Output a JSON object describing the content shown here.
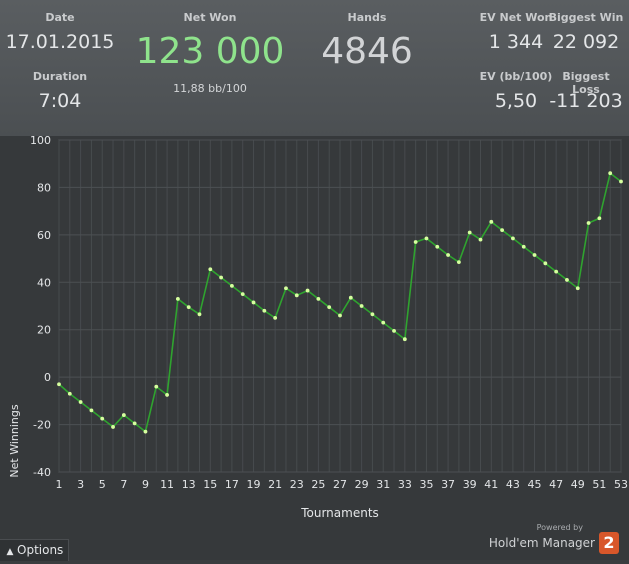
{
  "stats": {
    "date": {
      "label": "Date",
      "value": "17.01.2015"
    },
    "duration": {
      "label": "Duration",
      "value": "7:04"
    },
    "net_won": {
      "label": "Net Won",
      "value": "123 000",
      "sub": "11,88 bb/100"
    },
    "hands": {
      "label": "Hands",
      "value": "4846"
    },
    "ev_net_won": {
      "label": "EV Net Won",
      "value": "1 344"
    },
    "biggest_win": {
      "label": "Biggest Win",
      "value": "22 092"
    },
    "ev_bb100": {
      "label": "EV (bb/100)",
      "value": "5,50"
    },
    "biggest_loss": {
      "label": "Biggest Loss",
      "value": "-11 203"
    }
  },
  "colors": {
    "net_won": "#8fe38c",
    "line": "#2fa32f",
    "point": "#d6ff9f"
  },
  "chart_data": {
    "type": "line",
    "xlabel": "Tournaments",
    "ylabel": "Net Winnings",
    "ylim": [
      -40,
      100
    ],
    "yticks": [
      -40,
      -20,
      0,
      20,
      40,
      60,
      80,
      100
    ],
    "xlim": [
      1,
      53
    ],
    "xticks": [
      1,
      3,
      5,
      7,
      9,
      11,
      13,
      15,
      17,
      19,
      21,
      23,
      25,
      27,
      29,
      31,
      33,
      35,
      37,
      39,
      41,
      43,
      45,
      47,
      49,
      51,
      53
    ],
    "grid": true,
    "series": [
      {
        "x": [
          1,
          2,
          3,
          4,
          5,
          6,
          7,
          8,
          9,
          10,
          11,
          12,
          13,
          14,
          15,
          16,
          17,
          18,
          19,
          20,
          21,
          22,
          23,
          24,
          25,
          26,
          27,
          28,
          29,
          30,
          31,
          32,
          33,
          34,
          35,
          36,
          37,
          38,
          39,
          40,
          41,
          42,
          43,
          44,
          45,
          46,
          47,
          48,
          49,
          50,
          51,
          52,
          53
        ],
        "y": [
          -3,
          -7,
          -10.5,
          -14,
          -17.5,
          -21,
          -16,
          -19.5,
          -23,
          -4,
          -7.5,
          33,
          29.5,
          26.5,
          45.5,
          42,
          38.5,
          35,
          31.5,
          28,
          25,
          37.5,
          34.5,
          36.5,
          33,
          29.5,
          26,
          33.5,
          30,
          26.5,
          23,
          19.5,
          16,
          57,
          58.5,
          55,
          51.5,
          48.5,
          61,
          58,
          65.5,
          62,
          58.5,
          55,
          51.5,
          48,
          44.5,
          41,
          37.5,
          65,
          67,
          86,
          82.5
        ]
      }
    ]
  },
  "options": {
    "label": "Options"
  },
  "brand": {
    "powered_by": "Powered by",
    "name": "Hold'em Manager",
    "version": "2"
  }
}
